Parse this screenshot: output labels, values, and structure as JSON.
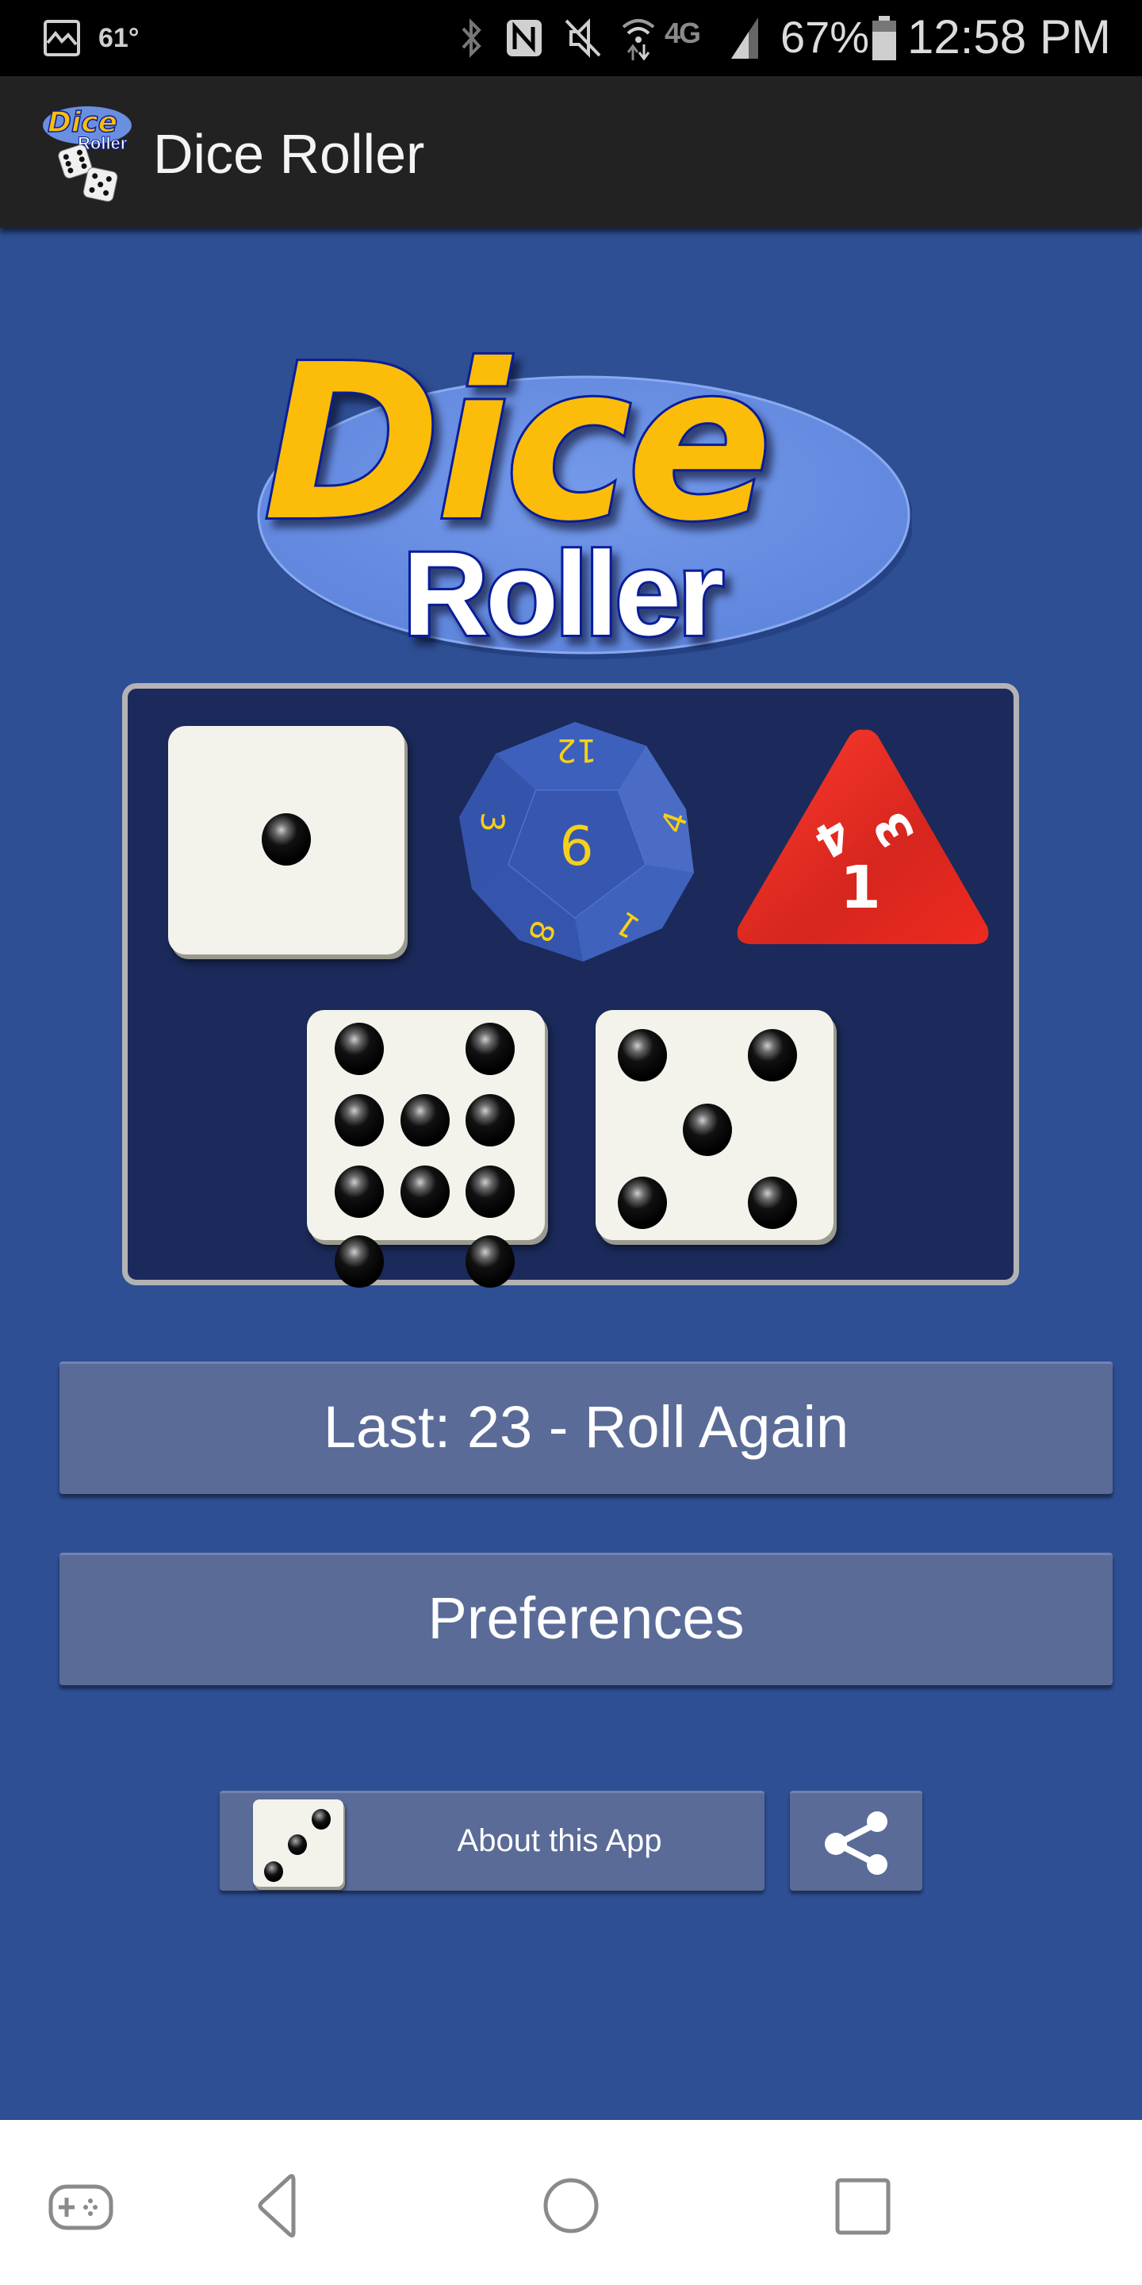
{
  "status_bar": {
    "gallery_icon": "image-icon",
    "temperature": "61°",
    "icons": [
      "bluetooth-icon",
      "nfc-icon",
      "mute-icon",
      "wifi-icon",
      "4g-lte-icon",
      "signal-icon"
    ],
    "battery_percent": "67%",
    "time": "12:58 PM"
  },
  "action_bar": {
    "app_icon": "dice-roller-app-icon",
    "title": "Dice Roller"
  },
  "logo": {
    "line1": "Dice",
    "line2": "Roller",
    "colors": {
      "dice_text": "#fbbd0a",
      "ellipse": "#6a8fe0",
      "outline": "#0a1d9a"
    }
  },
  "dice": [
    {
      "type": "d6",
      "value": 1,
      "color": "#f3f3ec"
    },
    {
      "type": "d12",
      "value": 6,
      "visible_numbers": [
        "12",
        "3",
        "6",
        "4",
        "8",
        "1"
      ],
      "color": "#3a5cb8",
      "number_color": "#f5d01a"
    },
    {
      "type": "d4",
      "value": 1,
      "visible_numbers": [
        "4",
        "3",
        "1"
      ],
      "color": "#e0261e",
      "number_color": "#ffffff"
    },
    {
      "type": "d10-pips",
      "value": 10,
      "color": "#f3f3ec"
    },
    {
      "type": "d6",
      "value": 5,
      "color": "#f3f3ec"
    }
  ],
  "roll_button": {
    "prefix": "Last:",
    "last_total": "23",
    "label": "Last:  23 - Roll Again"
  },
  "preferences_button": {
    "label": "Preferences"
  },
  "about_button": {
    "label": "About this App",
    "icon": "dice-three-icon"
  },
  "share_button": {
    "icon": "share-icon"
  },
  "nav_bar": {
    "items": [
      "gamepad-icon",
      "back-icon",
      "home-icon",
      "recents-icon"
    ]
  },
  "colors": {
    "background": "#2e4f94",
    "panel": "#1b2a5a",
    "button": "#5a6b98",
    "action_bar": "#222222"
  }
}
